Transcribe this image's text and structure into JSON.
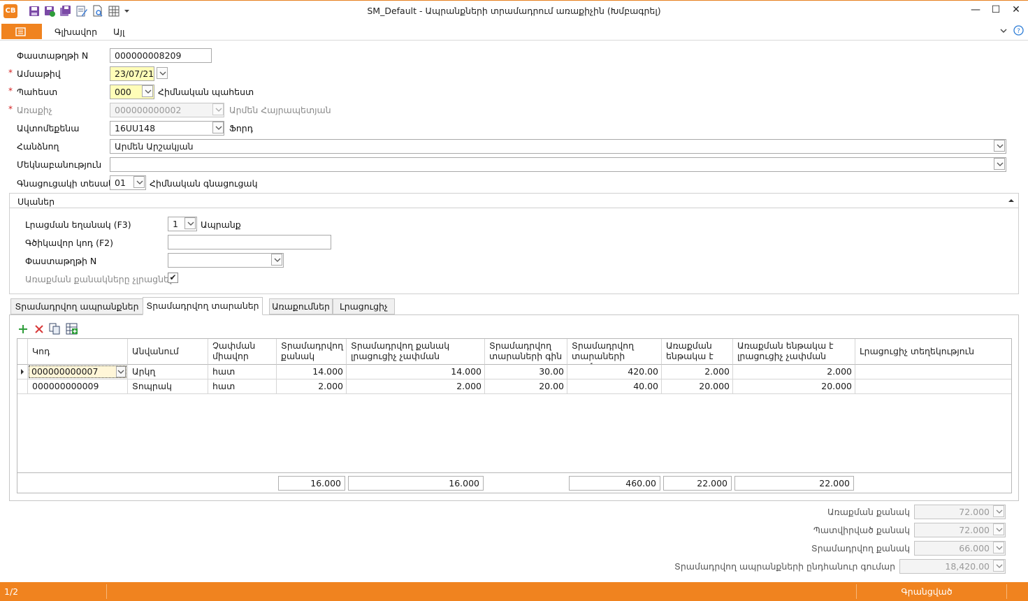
{
  "window": {
    "title": "SM_Default - Ապրանքների տրամադրում առաքիչին (Խմբագրել)",
    "logo_text": "CB",
    "minimize": "—",
    "maximize": "☐",
    "close": "✕"
  },
  "menu": {
    "main": "Գլխավոր",
    "other": "Այլ"
  },
  "form": {
    "doc_number": {
      "label": "Փաստաթղթի N",
      "value": "000000008209"
    },
    "date": {
      "required": "*",
      "label": "Ամսաթիվ",
      "value": "23/07/21"
    },
    "warehouse": {
      "required": "*",
      "label": "Պահեստ",
      "value": "000",
      "name": "Հիմնական պահեստ"
    },
    "forwarder": {
      "required": "*",
      "label": "Առաքիչ",
      "value": "000000000002",
      "name": "Արմեն Հայրապետյան"
    },
    "vehicle": {
      "label": "Ավտոմեքենա",
      "value": "16UU148",
      "name": "Ֆորդ"
    },
    "deliverer": {
      "label": "Հանձնող",
      "value": "Արմեն Արշակյան"
    },
    "comment": {
      "label": "Մեկնաբանություն",
      "value": ""
    },
    "price_type": {
      "label": "Գնացուցակի տեսակ",
      "value": "01",
      "name": "Հիմնական գնացուցակ"
    }
  },
  "group": {
    "title": "Սկաներ",
    "fill_mode": {
      "label": "Լրացման եղանակ (F3)",
      "value": "1",
      "name": "Ապրանք"
    },
    "barcode": {
      "label": "Գծիկավոր կոդ (F2)",
      "value": ""
    },
    "document": {
      "label": "Փաստաթղթի N",
      "value": ""
    },
    "no_fill_qty": {
      "label": "Առաքման քանակները չլրացնել",
      "checked": "✔"
    }
  },
  "tabs": [
    "Տրամադրվող ապրանքներ",
    "Տրամադրվող տարաներ",
    "Առաքումներ",
    "Լրացուցիչ"
  ],
  "active_tab": "Տրամադրվող տարաներ",
  "grid": {
    "columns": [
      "Կոդ",
      "Անվանում",
      "Չափման միավոր",
      "Տրամադրվող քանակ",
      "Տրամադրվող քանակ լրացուցիչ չափման",
      "Տրամադրվող տարաների գին",
      "Տրամադրվող տարաների գումար",
      "Առաքման ենթակա է",
      "Առաքման ենթակա է լրացուցիչ չափման",
      "Լրացուցիչ տեղեկություն"
    ],
    "rows": [
      [
        "000000000007",
        "Արկղ",
        "հատ",
        "14.000",
        "14.000",
        "30.00",
        "420.00",
        "2.000",
        "2.000",
        ""
      ],
      [
        "000000000009",
        "Տոպրակ",
        "հատ",
        "2.000",
        "2.000",
        "20.00",
        "40.00",
        "20.000",
        "20.000",
        ""
      ]
    ],
    "footer": {
      "qty": "16.000",
      "qty_extra": "16.000",
      "sum": "460.00",
      "deliver": "22.000",
      "deliver_extra": "22.000"
    }
  },
  "totals": {
    "delivery_qty": {
      "label": "Առաքման քանակ",
      "value": "72.000"
    },
    "ordered_qty": {
      "label": "Պատվիրված քանակ",
      "value": "72.000"
    },
    "supplied_qty": {
      "label": "Տրամադրվող քանակ",
      "value": "66.000"
    },
    "supplied_total": {
      "label": "Տրամադրվող ապրանքների ընդհանուր գումար",
      "value": "18,420.00"
    }
  },
  "status": {
    "page": "1/2",
    "state": "Գրանցված"
  },
  "colors": {
    "accent": "#f0831f",
    "required": "#d21f1f",
    "highlight": "#fffdb8"
  }
}
